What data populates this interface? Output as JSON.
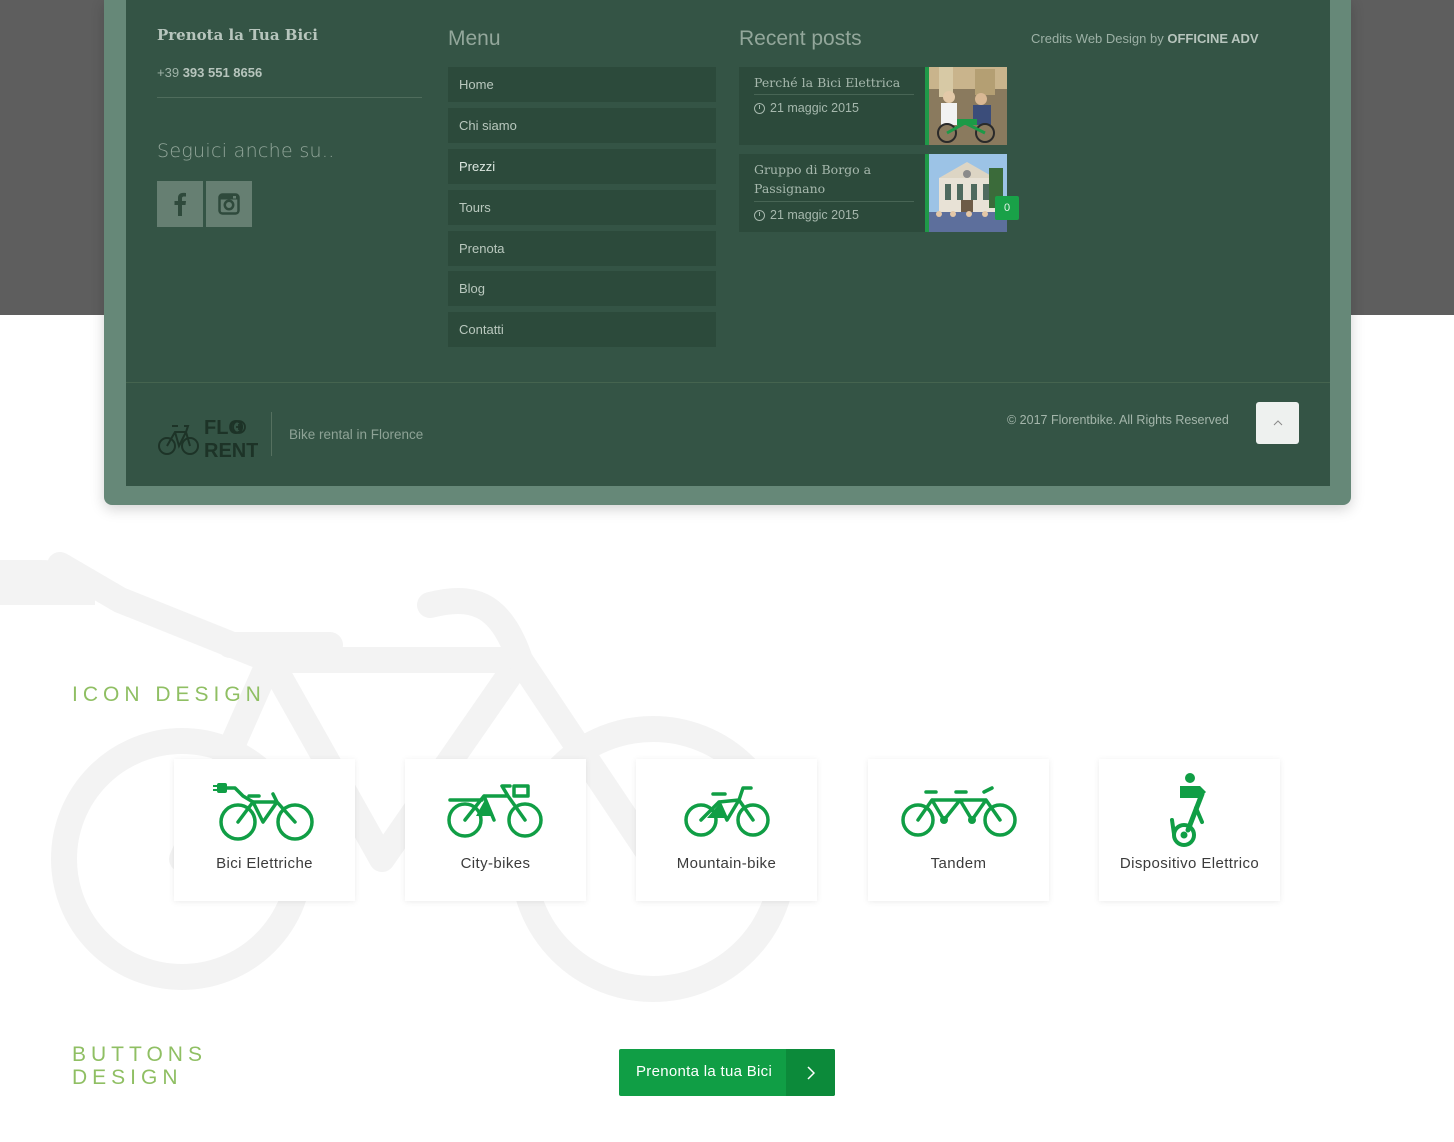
{
  "footer": {
    "col1": {
      "title": "Prenota la Tua Bici",
      "phone_prefix": "+39",
      "phone_number": "393 551 8656",
      "social_title": "Seguici anche su..",
      "social_icons": [
        "facebook-icon",
        "instagram-icon"
      ]
    },
    "menu": {
      "title": "Menu",
      "items": [
        {
          "label": "Home"
        },
        {
          "label": "Chi siamo"
        },
        {
          "label": "Prezzi"
        },
        {
          "label": "Tours"
        },
        {
          "label": "Prenota"
        },
        {
          "label": "Blog"
        },
        {
          "label": "Contatti"
        }
      ],
      "active_label": "Prezzi"
    },
    "posts": {
      "title": "Recent posts",
      "items": [
        {
          "title": "Perché la Bici Elettrica",
          "date": "21 maggic 2015"
        },
        {
          "title": "Gruppo di Borgo a Passignano",
          "date": "21 maggic 2015",
          "comments": "0"
        }
      ]
    },
    "credits": {
      "prefix": "Credits Web Design by",
      "company": "OFFICINE ADV"
    },
    "bottom": {
      "logo_line1": "FLO",
      "logo_line2": "RENT",
      "tagline": "Bike rental in Florence",
      "copyright": "© 2017 Florentbike. All Rights Reserved"
    }
  },
  "icon_section": {
    "title": "ICON DESIGN",
    "cards": [
      {
        "label": "Bici Elettriche",
        "icon": "electric-bike-icon"
      },
      {
        "label": "City-bikes",
        "icon": "city-bike-icon"
      },
      {
        "label": "Mountain-bike",
        "icon": "mountain-bike-icon"
      },
      {
        "label": "Tandem",
        "icon": "tandem-bike-icon"
      },
      {
        "label": "Dispositivo Elettrico",
        "icon": "segway-icon"
      }
    ]
  },
  "buttons_section": {
    "title_line1": "BUTTONS",
    "title_line2": "DESIGN",
    "cta_label": "Prenonta la tua Bici"
  },
  "colors": {
    "brand_green": "#109e45",
    "footer_panel": "#345445",
    "accent_light_green": "#8fbf63"
  }
}
